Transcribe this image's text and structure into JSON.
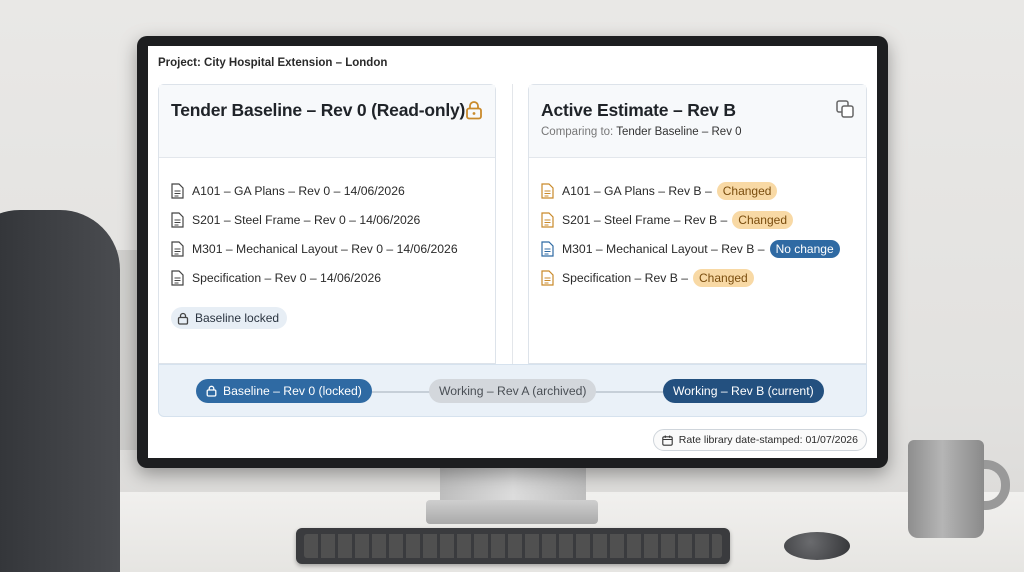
{
  "project": {
    "label": "Project: City Hospital Extension – London"
  },
  "baseline_panel": {
    "title": "Tender Baseline – Rev 0 (Read-only)",
    "icon": "lock-icon",
    "documents": [
      {
        "text": "A101 – GA Plans – Rev 0 – 14/06/2026"
      },
      {
        "text": "S201 – Steel Frame – Rev 0 – 14/06/2026"
      },
      {
        "text": "M301 – Mechanical Layout – Rev 0 – 14/06/2026"
      },
      {
        "text": "Specification – Rev 0 – 14/06/2026"
      }
    ],
    "locked_chip": "Baseline locked"
  },
  "estimate_panel": {
    "title": "Active Estimate – Rev B",
    "comparing_prefix": "Comparing to:",
    "comparing_target": "Tender Baseline – Rev 0",
    "icon": "compare-icon",
    "documents": [
      {
        "text": "A101 – GA Plans – Rev B –",
        "status": "Changed"
      },
      {
        "text": "S201 – Steel Frame – Rev B –",
        "status": "Changed"
      },
      {
        "text": "M301 – Mechanical Layout – Rev B –",
        "status": "No change"
      },
      {
        "text": "Specification – Rev B –",
        "status": "Changed"
      }
    ]
  },
  "timeline": {
    "baseline": "Baseline – Rev 0 (locked)",
    "archived": "Working – Rev A (archived)",
    "current": "Working – Rev B (current)"
  },
  "rate_library": {
    "label": "Rate library date-stamped: 01/07/2026"
  },
  "colors": {
    "accent": "#2f6aa3",
    "current": "#23507f",
    "changed_bg": "#f8d9a5",
    "changed_icon": "#c98a2b"
  }
}
